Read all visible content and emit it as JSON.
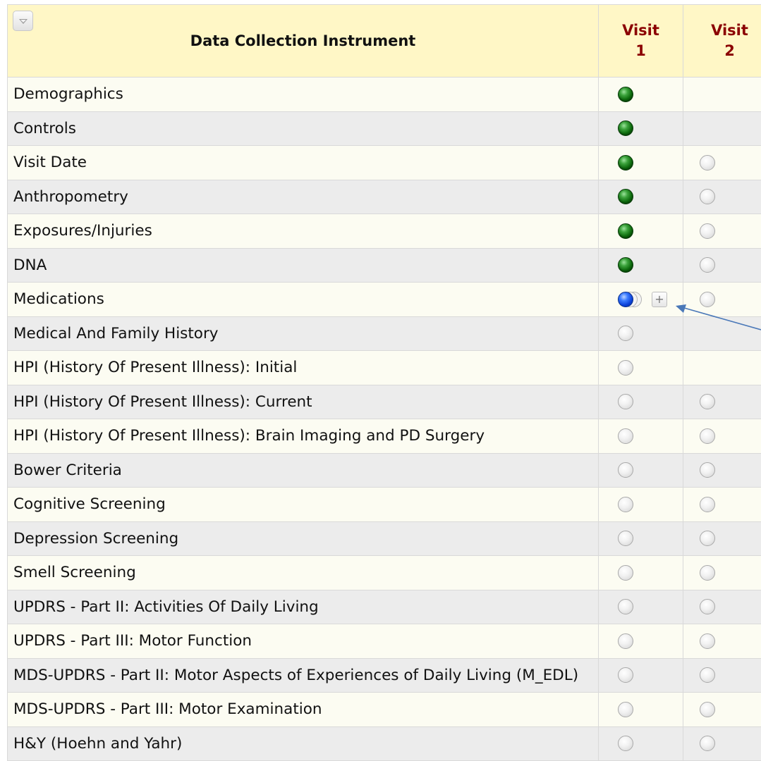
{
  "header": {
    "instrument_label": "Data Collection Instrument",
    "visits": [
      {
        "line1": "Visit",
        "line2": "1"
      },
      {
        "line1": "Visit",
        "line2": "2"
      }
    ]
  },
  "add_button_label": "+",
  "status_colors": {
    "complete": "#0d6a0d",
    "repeating": "#0a3fd6",
    "incomplete_empty": "#d2d2d2",
    "arrow": "#4a78b8"
  },
  "rows": [
    {
      "name": "Demographics",
      "visit1": "complete",
      "visit2": "none"
    },
    {
      "name": "Controls",
      "visit1": "complete",
      "visit2": "none"
    },
    {
      "name": "Visit Date",
      "visit1": "complete",
      "visit2": "empty"
    },
    {
      "name": "Anthropometry",
      "visit1": "complete",
      "visit2": "empty"
    },
    {
      "name": "Exposures/Injuries",
      "visit1": "complete",
      "visit2": "empty"
    },
    {
      "name": "DNA",
      "visit1": "complete",
      "visit2": "empty"
    },
    {
      "name": "Medications",
      "visit1": "repeating",
      "visit2": "empty"
    },
    {
      "name": "Medical And Family History",
      "visit1": "empty",
      "visit2": "none"
    },
    {
      "name": "HPI (History Of Present Illness): Initial",
      "visit1": "empty",
      "visit2": "none"
    },
    {
      "name": "HPI (History Of Present Illness): Current",
      "visit1": "empty",
      "visit2": "empty"
    },
    {
      "name": "HPI (History Of Present Illness): Brain Imaging and PD Surgery",
      "visit1": "empty",
      "visit2": "empty"
    },
    {
      "name": "Bower Criteria",
      "visit1": "empty",
      "visit2": "empty"
    },
    {
      "name": "Cognitive Screening",
      "visit1": "empty",
      "visit2": "empty"
    },
    {
      "name": "Depression Screening",
      "visit1": "empty",
      "visit2": "empty"
    },
    {
      "name": "Smell Screening",
      "visit1": "empty",
      "visit2": "empty"
    },
    {
      "name": "UPDRS - Part II: Activities Of Daily Living",
      "visit1": "empty",
      "visit2": "empty"
    },
    {
      "name": "UPDRS - Part III: Motor Function",
      "visit1": "empty",
      "visit2": "empty"
    },
    {
      "name": "MDS-UPDRS - Part II: Motor Aspects of Experiences of Daily Living (M_EDL)",
      "visit1": "empty",
      "visit2": "empty"
    },
    {
      "name": "MDS-UPDRS - Part III: Motor Examination",
      "visit1": "empty",
      "visit2": "empty"
    },
    {
      "name": "H&Y (Hoehn and Yahr)",
      "visit1": "empty",
      "visit2": "empty"
    }
  ]
}
